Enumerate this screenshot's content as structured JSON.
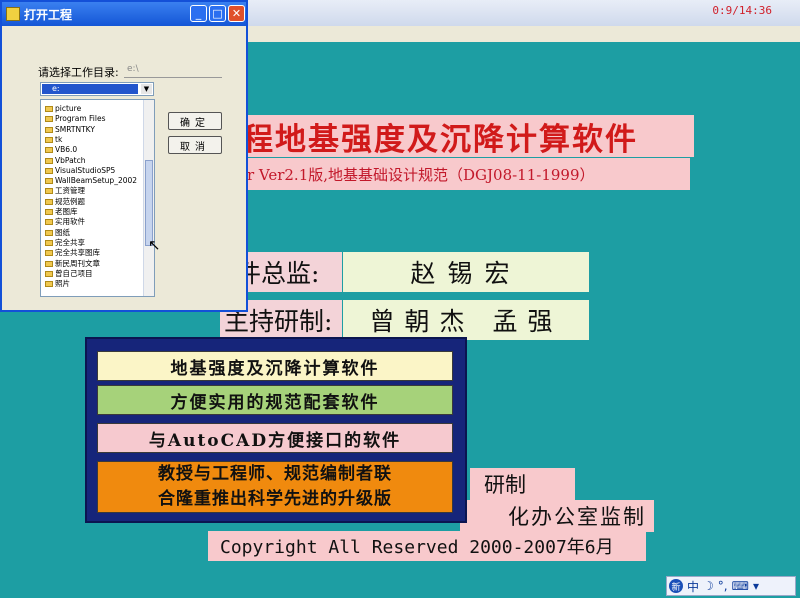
{
  "app": {
    "clock": "0:9/14:36",
    "title": "程地基强度及沉降计算软件",
    "version": "ar Ver2.1版,地基基础设计规范（DGJ08-11-1999）",
    "director_label": "件总监:",
    "director_name": "赵锡宏",
    "lead_label": "主持研制:",
    "lead_names": "曾朝杰 孟强",
    "research_label": "研制",
    "supervision_label": "化办公室监制",
    "copyright": "Copyright All Reserved 2000-2007年6月"
  },
  "features": {
    "item1": "地基强度及沉降计算软件",
    "item2": "方便实用的规范配套软件",
    "item3": "与AutoCAD方便接口的软件",
    "item4_line1": "教授与工程师、规范编制者联",
    "item4_line2": "合隆重推出科学先进的升级版"
  },
  "dialog": {
    "title": "打开工程",
    "dir_label": "请选择工作目录:",
    "dir_value": "e:\\",
    "drive_value": "e:",
    "ok_label": "确定",
    "cancel_label": "取消",
    "folders": [
      "picture",
      "Program Files",
      "SMRTNTKY",
      "tk",
      "VB6.0",
      "VbPatch",
      "VisualStudioSP5",
      "WallBeamSetup_2002",
      "工资管理",
      "规范例题",
      "老图库",
      "实用软件",
      "图纸",
      "完全共享",
      "完全共享图库",
      "新民周刊文章",
      "曾自己项目",
      "照片"
    ]
  },
  "ime": {
    "logo": "新",
    "mode": "中"
  },
  "colors": {
    "teal_background": "#1d9ea3",
    "title_red": "#d11a1a",
    "pink_panel": "#f8c9cc",
    "navy_box": "#16257a",
    "orange_panel": "#f08a0e"
  }
}
